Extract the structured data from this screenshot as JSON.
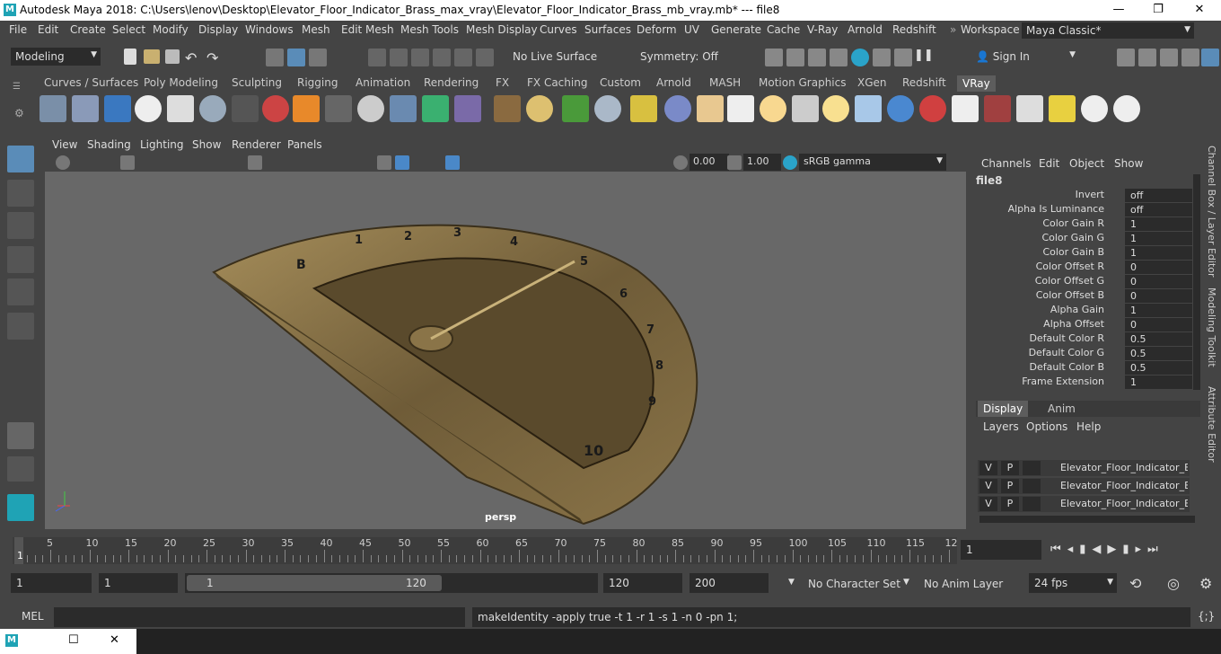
{
  "window": {
    "title": "Autodesk Maya 2018: C:\\Users\\lenov\\Desktop\\Elevator_Floor_Indicator_Brass_max_vray\\Elevator_Floor_Indicator_Brass_mb_vray.mb*   ---   file8",
    "logo": "M",
    "minimize": "—",
    "restore": "❐",
    "close": "✕"
  },
  "menu": [
    "File",
    "Edit",
    "Create",
    "Select",
    "Modify",
    "Display",
    "Windows",
    "Mesh",
    "Edit Mesh",
    "Mesh Tools",
    "Mesh Display",
    "Curves",
    "Surfaces",
    "Deform",
    "UV",
    "Generate",
    "Cache",
    "V-Ray",
    "Arnold",
    "Redshift"
  ],
  "workspace": {
    "label": "Workspace :",
    "value": "Maya Classic*"
  },
  "statusline": {
    "mode": "Modeling",
    "live_surface": "No Live Surface",
    "symmetry": "Symmetry: Off",
    "sign_in": "Sign In"
  },
  "shelf_tabs": [
    "Curves / Surfaces",
    "Poly Modeling",
    "Sculpting",
    "Rigging",
    "Animation",
    "Rendering",
    "FX",
    "FX Caching",
    "Custom",
    "Arnold",
    "MASH",
    "Motion Graphics",
    "XGen",
    "Redshift",
    "VRay"
  ],
  "shelf_active": "VRay",
  "viewport": {
    "menu": [
      "View",
      "Shading",
      "Lighting",
      "Show",
      "Renderer",
      "Panels"
    ],
    "exposure": "0.00",
    "gamma": "1.00",
    "color_space": "sRGB gamma",
    "camera": "persp"
  },
  "channel_box": {
    "menu": [
      "Channels",
      "Edit",
      "Object",
      "Show"
    ],
    "node": "file8",
    "attributes": [
      {
        "name": "Invert",
        "value": "off"
      },
      {
        "name": "Alpha Is Luminance",
        "value": "off"
      },
      {
        "name": "Color Gain R",
        "value": "1"
      },
      {
        "name": "Color Gain G",
        "value": "1"
      },
      {
        "name": "Color Gain B",
        "value": "1"
      },
      {
        "name": "Color Offset R",
        "value": "0"
      },
      {
        "name": "Color Offset G",
        "value": "0"
      },
      {
        "name": "Color Offset B",
        "value": "0"
      },
      {
        "name": "Alpha Gain",
        "value": "1"
      },
      {
        "name": "Alpha Offset",
        "value": "0"
      },
      {
        "name": "Default Color R",
        "value": "0.5"
      },
      {
        "name": "Default Color G",
        "value": "0.5"
      },
      {
        "name": "Default Color B",
        "value": "0.5"
      },
      {
        "name": "Frame Extension",
        "value": "1"
      }
    ]
  },
  "layer_editor": {
    "tabs": [
      "Display",
      "Anim"
    ],
    "menu": [
      "Layers",
      "Options",
      "Help"
    ],
    "layers": [
      {
        "v": "V",
        "p": "P",
        "name": "Elevator_Floor_Indicator_Bra"
      },
      {
        "v": "V",
        "p": "P",
        "name": "Elevator_Floor_Indicator_Bra"
      },
      {
        "v": "V",
        "p": "P",
        "name": "Elevator_Floor_Indicator_Bra"
      }
    ]
  },
  "side_tabs": [
    "Channel Box / Layer Editor",
    "Modeling Toolkit",
    "Attribute Editor"
  ],
  "time_slider": {
    "ticks": [
      "5",
      "10",
      "15",
      "20",
      "25",
      "30",
      "35",
      "40",
      "45",
      "50",
      "55",
      "60",
      "65",
      "70",
      "75",
      "80",
      "85",
      "90",
      "95",
      "100",
      "105",
      "110",
      "115",
      "12"
    ],
    "current_marker": "1",
    "current_frame": "1"
  },
  "range_slider": {
    "start": "1",
    "playback_start": "1",
    "slider_start": "1",
    "slider_end": "120",
    "playback_end": "120",
    "end": "200",
    "character_set": "No Character Set",
    "anim_layer": "No Anim Layer",
    "fps": "24 fps"
  },
  "command_line": {
    "lang": "MEL",
    "feedback": "makeIdentity -apply true -t 1 -r 1 -s 1 -n 0 -pn 1;"
  },
  "colors": {
    "ui_bg": "#444444",
    "field_bg": "#2b2b2b",
    "viewport_bg": "#686868",
    "brass": "#8a7448"
  }
}
